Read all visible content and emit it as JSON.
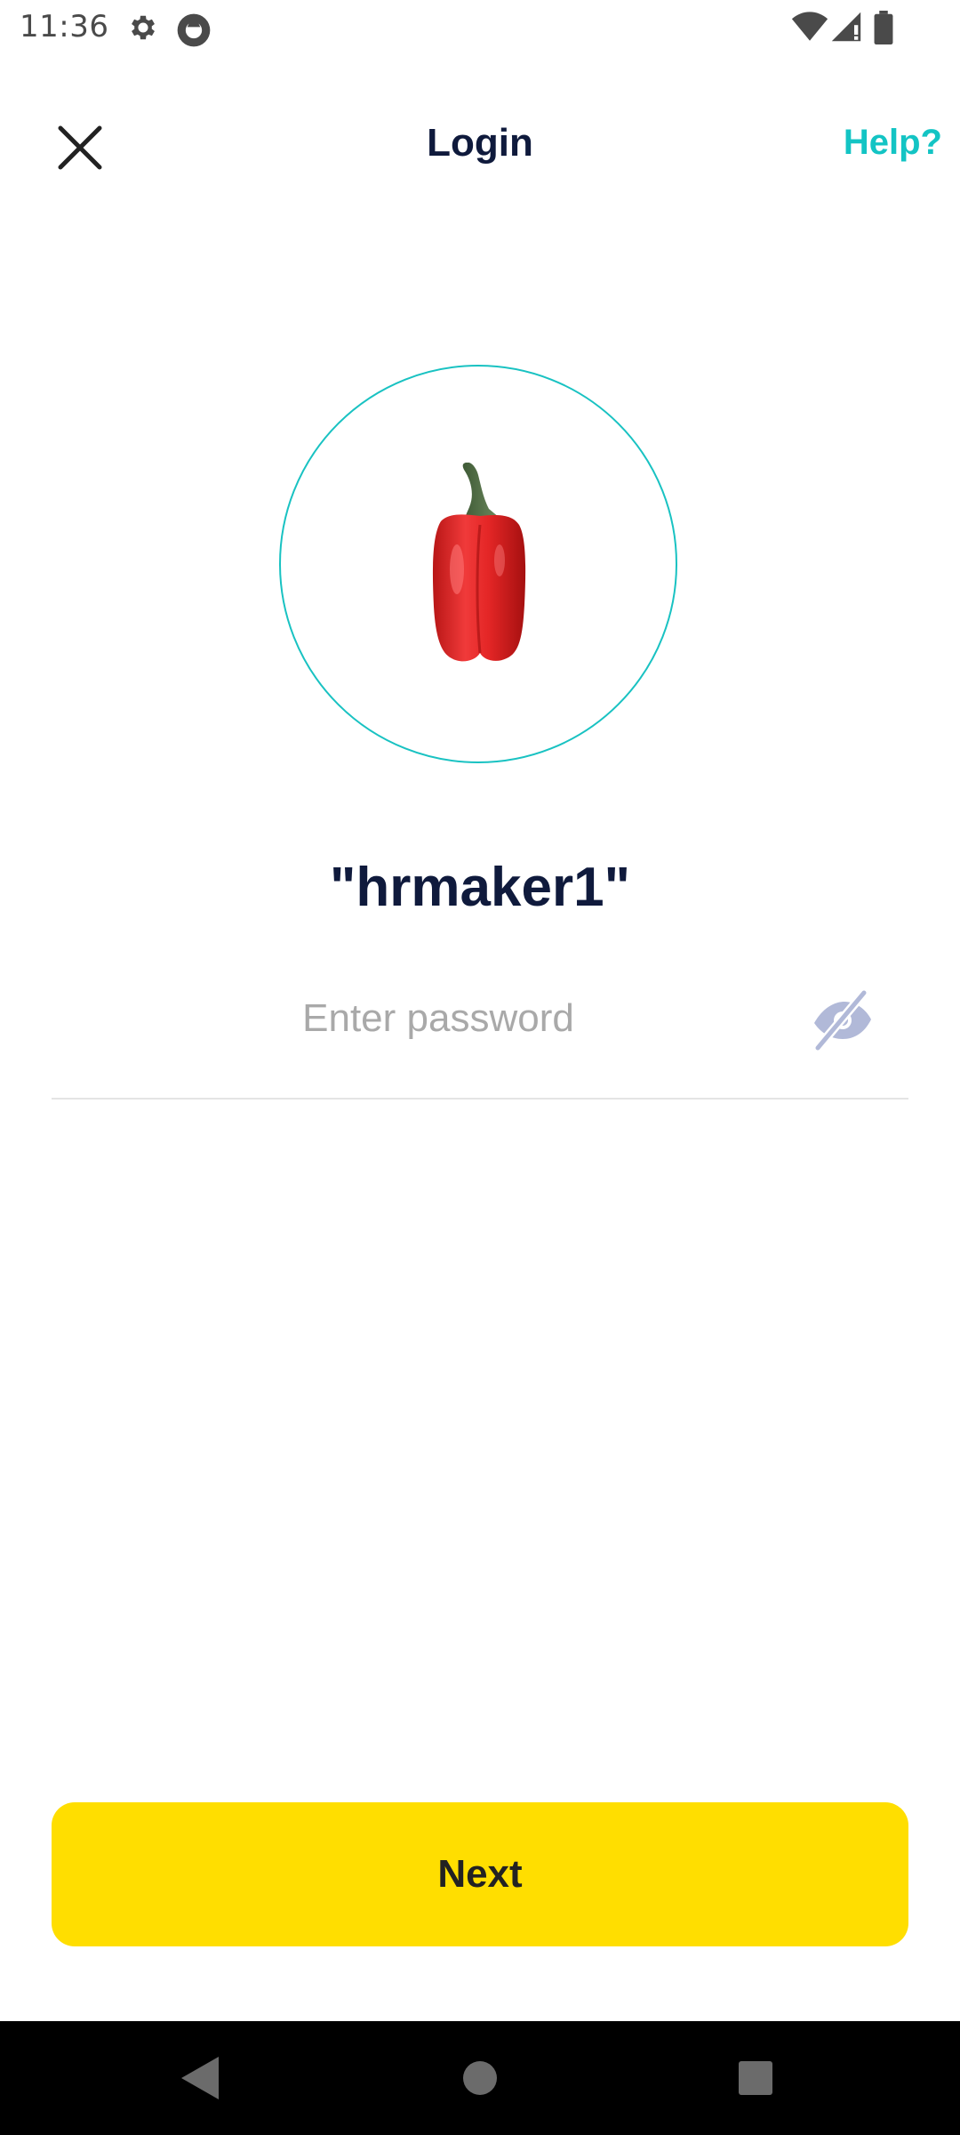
{
  "status_bar": {
    "time": "11:36",
    "icons": [
      "gear-icon",
      "sync-icon",
      "wifi-icon",
      "signal-icon",
      "battery-icon"
    ]
  },
  "header": {
    "title": "Login",
    "help_label": "Help?",
    "close_icon": "close-icon"
  },
  "profile": {
    "avatar": "red-bell-pepper",
    "username": "\"hrmaker1\""
  },
  "password": {
    "placeholder": "Enter password",
    "value": "",
    "visibility_icon": "eye-off-icon"
  },
  "actions": {
    "next_label": "Next"
  },
  "nav_bar": {
    "icons": [
      "back-icon",
      "home-icon",
      "recents-icon"
    ]
  },
  "colors": {
    "accent": "#13c4c4",
    "primary_button": "#ffde00",
    "text_dark": "#0f1a3c",
    "placeholder": "#a9a9a9",
    "eye_icon": "#b1b9d8"
  }
}
